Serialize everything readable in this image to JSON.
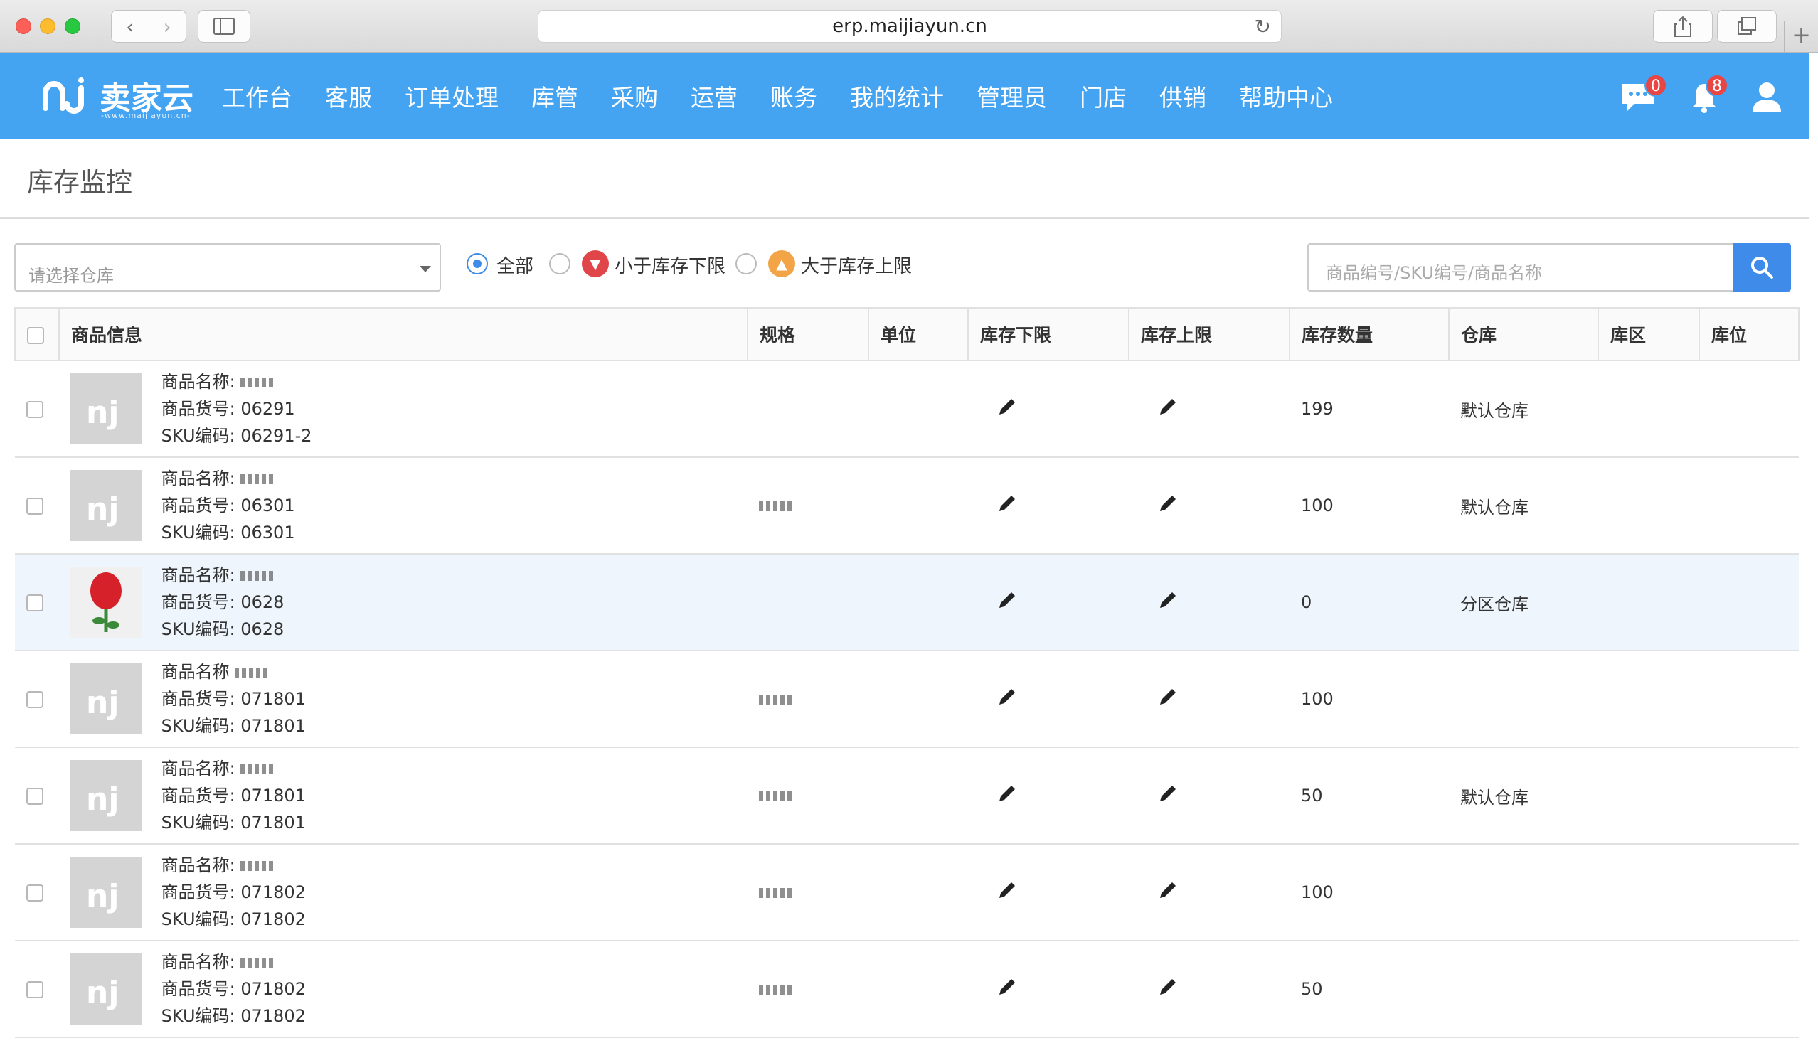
{
  "browser": {
    "url": "erp.maijiayun.cn"
  },
  "header": {
    "logo_text": "卖家云",
    "logo_sub": "-www.maijiayun.cn-",
    "nav": [
      "工作台",
      "客服",
      "订单处理",
      "库管",
      "采购",
      "运营",
      "账务",
      "我的统计",
      "管理员",
      "门店",
      "供销",
      "帮助中心"
    ],
    "message_count": "0",
    "notify_count": "8"
  },
  "page": {
    "title": "库存监控"
  },
  "filters": {
    "warehouse_placeholder": "请选择仓库",
    "radio_all": "全部",
    "radio_below": "小于库存下限",
    "radio_above": "大于库存上限",
    "search_placeholder": "商品编号/SKU编号/商品名称"
  },
  "table": {
    "columns": [
      "商品信息",
      "规格",
      "单位",
      "库存下限",
      "库存上限",
      "库存数量",
      "仓库",
      "库区",
      "库位"
    ],
    "rows": [
      {
        "name_label": "商品名称:",
        "code": "商品货号: 06291",
        "sku": "SKU编码: 06291-2",
        "qty": "199",
        "warehouse": "默认仓库",
        "image": "logo"
      },
      {
        "name_label": "商品名称:",
        "code": "商品货号: 06301",
        "sku": "SKU编码: 06301",
        "qty": "100",
        "warehouse": "默认仓库",
        "image": "logo"
      },
      {
        "name_label": "商品名称:",
        "code": "商品货号: 0628",
        "sku": "SKU编码: 0628",
        "qty": "0",
        "warehouse": "分区仓库",
        "image": "rose"
      },
      {
        "name_label": "商品名称",
        "code": "商品货号: 071801",
        "sku": "SKU编码: 071801",
        "qty": "100",
        "warehouse": "",
        "image": "logo"
      },
      {
        "name_label": "商品名称:",
        "code": "商品货号: 071801",
        "sku": "SKU编码: 071801",
        "qty": "50",
        "warehouse": "默认仓库",
        "image": "logo"
      },
      {
        "name_label": "商品名称:",
        "code": "商品货号: 071802",
        "sku": "SKU编码: 071802",
        "qty": "100",
        "warehouse": "",
        "image": "logo"
      },
      {
        "name_label": "商品名称:",
        "code": "商品货号: 071802",
        "sku": "SKU编码: 071802",
        "qty": "50",
        "warehouse": "",
        "image": "logo"
      }
    ]
  },
  "colors": {
    "header_bg": "#45a4f2",
    "accent": "#3e8be9",
    "badge": "#e84545",
    "below_icon": "#e0454a",
    "above_icon": "#f2a447"
  }
}
